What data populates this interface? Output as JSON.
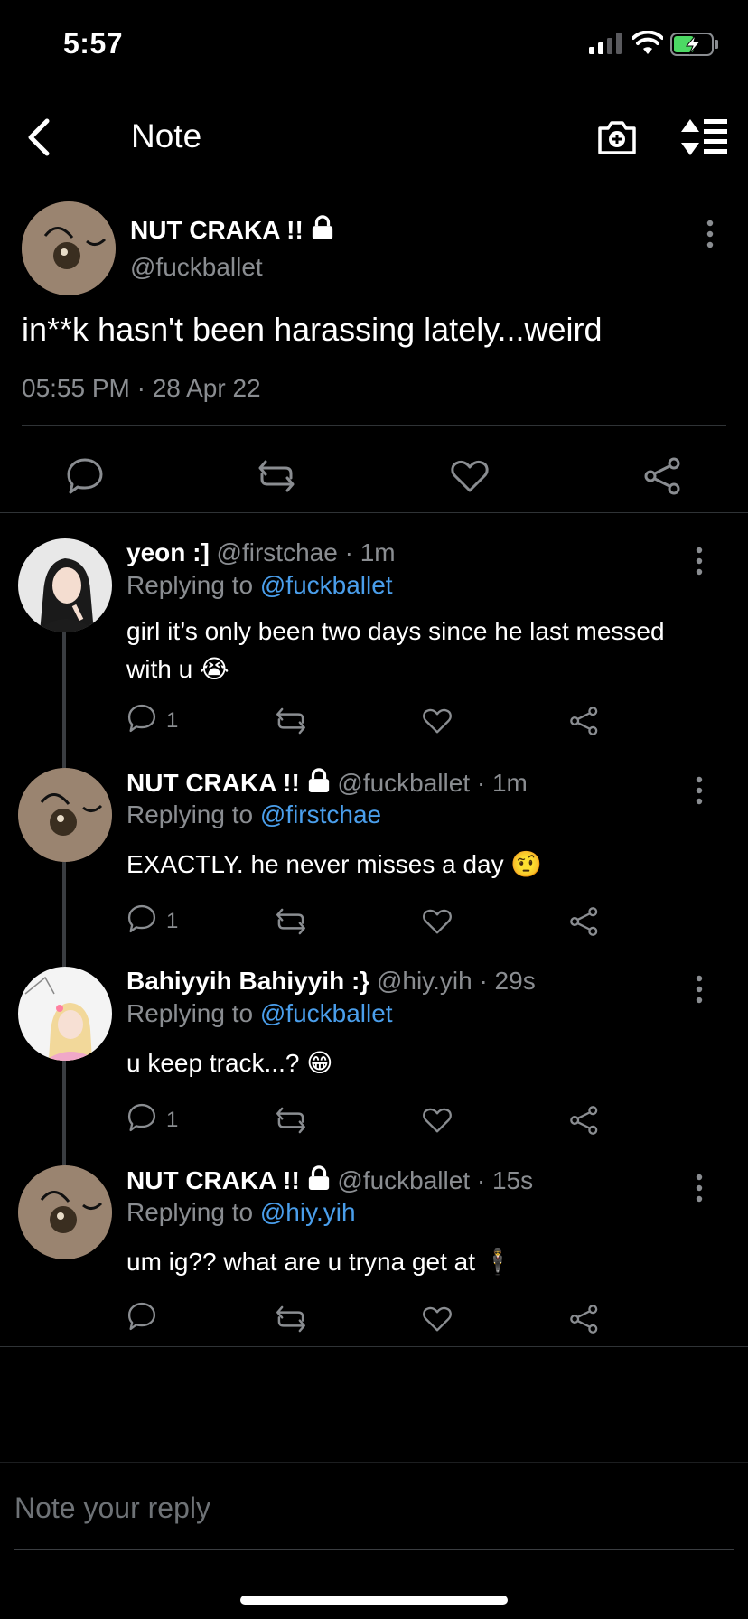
{
  "status_bar": {
    "time": "5:57"
  },
  "nav": {
    "title": "Note"
  },
  "main_note": {
    "author_name": "NUT CRAKA !!",
    "handle": "@fuckballet",
    "text": "in**k hasn't been harassing lately...weird",
    "timestamp": "05:55 PM · 28 Apr 22"
  },
  "replies": [
    {
      "name": "yeon :]",
      "meta": " @firstchae · 1m",
      "replying_label": "Replying to ",
      "replying_to": "@fuckballet",
      "text": "girl it’s only been two days since he last messed with u 😭",
      "reply_count": "1",
      "locked": false
    },
    {
      "name": "NUT CRAKA !!",
      "meta": " @fuckballet · 1m",
      "replying_label": "Replying to ",
      "replying_to": "@firstchae",
      "text": "EXACTLY. he never misses a day 🤨",
      "reply_count": "1",
      "locked": true
    },
    {
      "name": "Bahiyyih Bahiyyih :}",
      "meta": " @hiy.yih · 29s",
      "replying_label": "Replying to ",
      "replying_to": "@fuckballet",
      "text": "u keep track...? 😁",
      "reply_count": "1",
      "locked": false
    },
    {
      "name": "NUT CRAKA !!",
      "meta": " @fuckballet · 15s",
      "replying_label": "Replying to ",
      "replying_to": "@hiy.yih",
      "text": "um ig?? what are u tryna get at 🕴",
      "reply_count": "",
      "locked": true
    }
  ],
  "composer": {
    "placeholder": "Note your reply"
  },
  "colors": {
    "background": "#000000",
    "mention": "#4a9eeb",
    "muted": "#8a8d91",
    "battery": "#4cd964"
  }
}
